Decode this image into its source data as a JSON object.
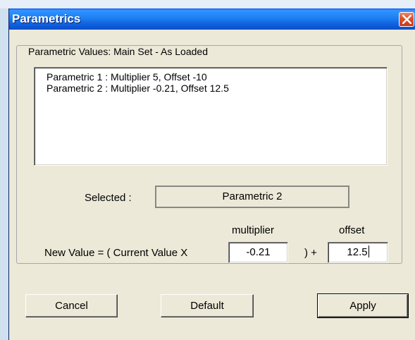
{
  "window": {
    "title": "Parametrics"
  },
  "group": {
    "legend": "Parametric Values: Main Set - As Loaded"
  },
  "parametrics_list": [
    "Parametric 1 : Multiplier 5, Offset -10",
    "Parametric 2 : Multiplier -0.21, Offset 12.5"
  ],
  "selected": {
    "label": "Selected :",
    "value": "Parametric 2"
  },
  "formula": {
    "multiplier_header": "multiplier",
    "offset_header": "offset",
    "prefix": "New Value = ( Current Value X",
    "mid": ") +",
    "multiplier_value": "-0.21",
    "offset_value": "12.5"
  },
  "buttons": {
    "cancel": "Cancel",
    "default": "Default",
    "apply": "Apply"
  },
  "colors": {
    "titlebar": "#0a4fc8",
    "dialog_bg": "#ece9d8",
    "close_button": "#e0532c"
  }
}
